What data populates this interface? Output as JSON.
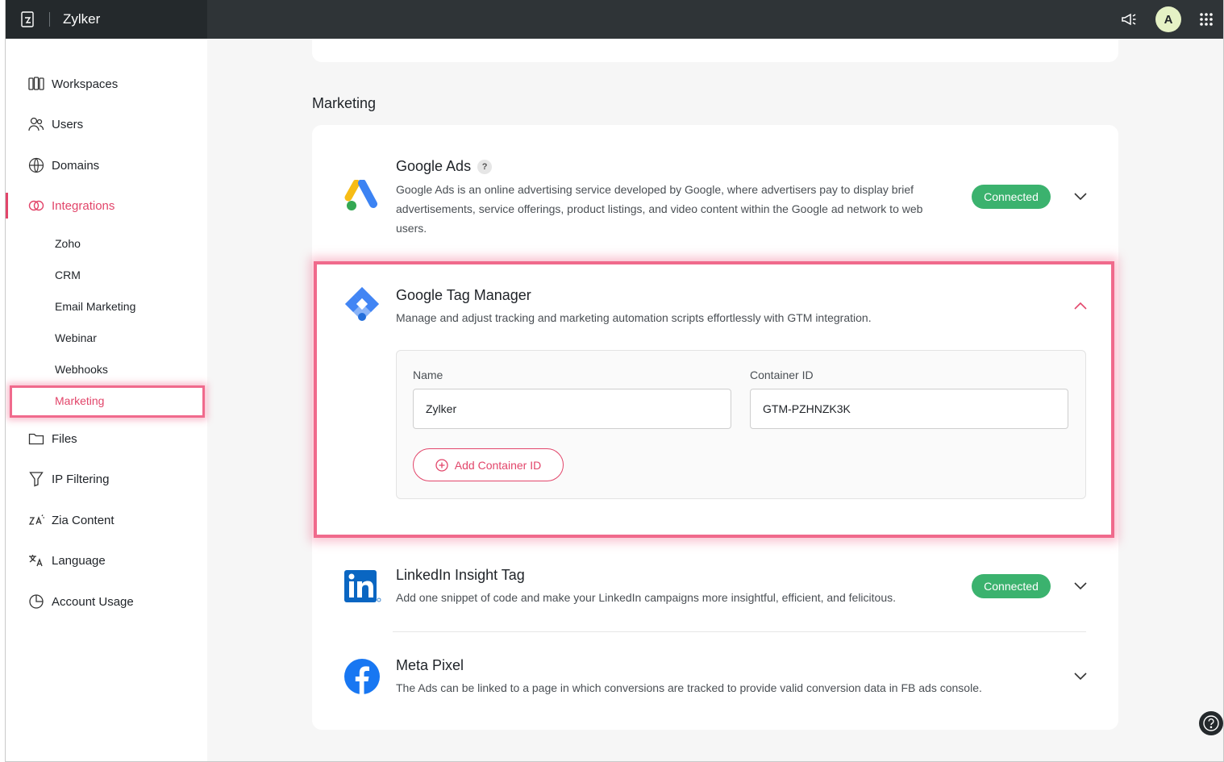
{
  "app": {
    "brand": "Zylker",
    "avatar_initial": "A"
  },
  "sidebar": {
    "items": [
      {
        "label": "Workspaces"
      },
      {
        "label": "Users"
      },
      {
        "label": "Domains"
      },
      {
        "label": "Integrations"
      },
      {
        "label": "Files"
      },
      {
        "label": "IP Filtering"
      },
      {
        "label": "Zia Content"
      },
      {
        "label": "Language"
      },
      {
        "label": "Account Usage"
      }
    ],
    "sub_items": [
      {
        "label": "Zoho"
      },
      {
        "label": "CRM"
      },
      {
        "label": "Email Marketing"
      },
      {
        "label": "Webinar"
      },
      {
        "label": "Webhooks"
      },
      {
        "label": "Marketing"
      }
    ],
    "active_item": "Integrations",
    "active_sub_item": "Marketing"
  },
  "main": {
    "section_title": "Marketing",
    "integrations": [
      {
        "name": "Google Ads",
        "help": "?",
        "description": "Google Ads is an online advertising service developed by Google, where advertisers pay to display brief advertisements, service offerings, product listings, and video content within the Google ad network to web users.",
        "status": "Connected"
      },
      {
        "name": "Google Tag Manager",
        "description": "Manage and adjust tracking and marketing automation scripts effortlessly with GTM integration.",
        "form": {
          "name_label": "Name",
          "name_value": "Zylker",
          "container_label": "Container ID",
          "container_value": "GTM-PZHNZK3K",
          "add_button": "Add Container ID"
        }
      },
      {
        "name": "LinkedIn Insight Tag",
        "description": "Add one snippet of code and make your LinkedIn campaigns more insightful, efficient, and felicitous.",
        "status": "Connected"
      },
      {
        "name": "Meta Pixel",
        "description": "The Ads can be linked to a page in which conversions are tracked to provide valid conversion data in FB ads console."
      }
    ]
  },
  "colors": {
    "accent": "#e2456a",
    "connected": "#3bb26e",
    "topbar": "#2f3437"
  }
}
